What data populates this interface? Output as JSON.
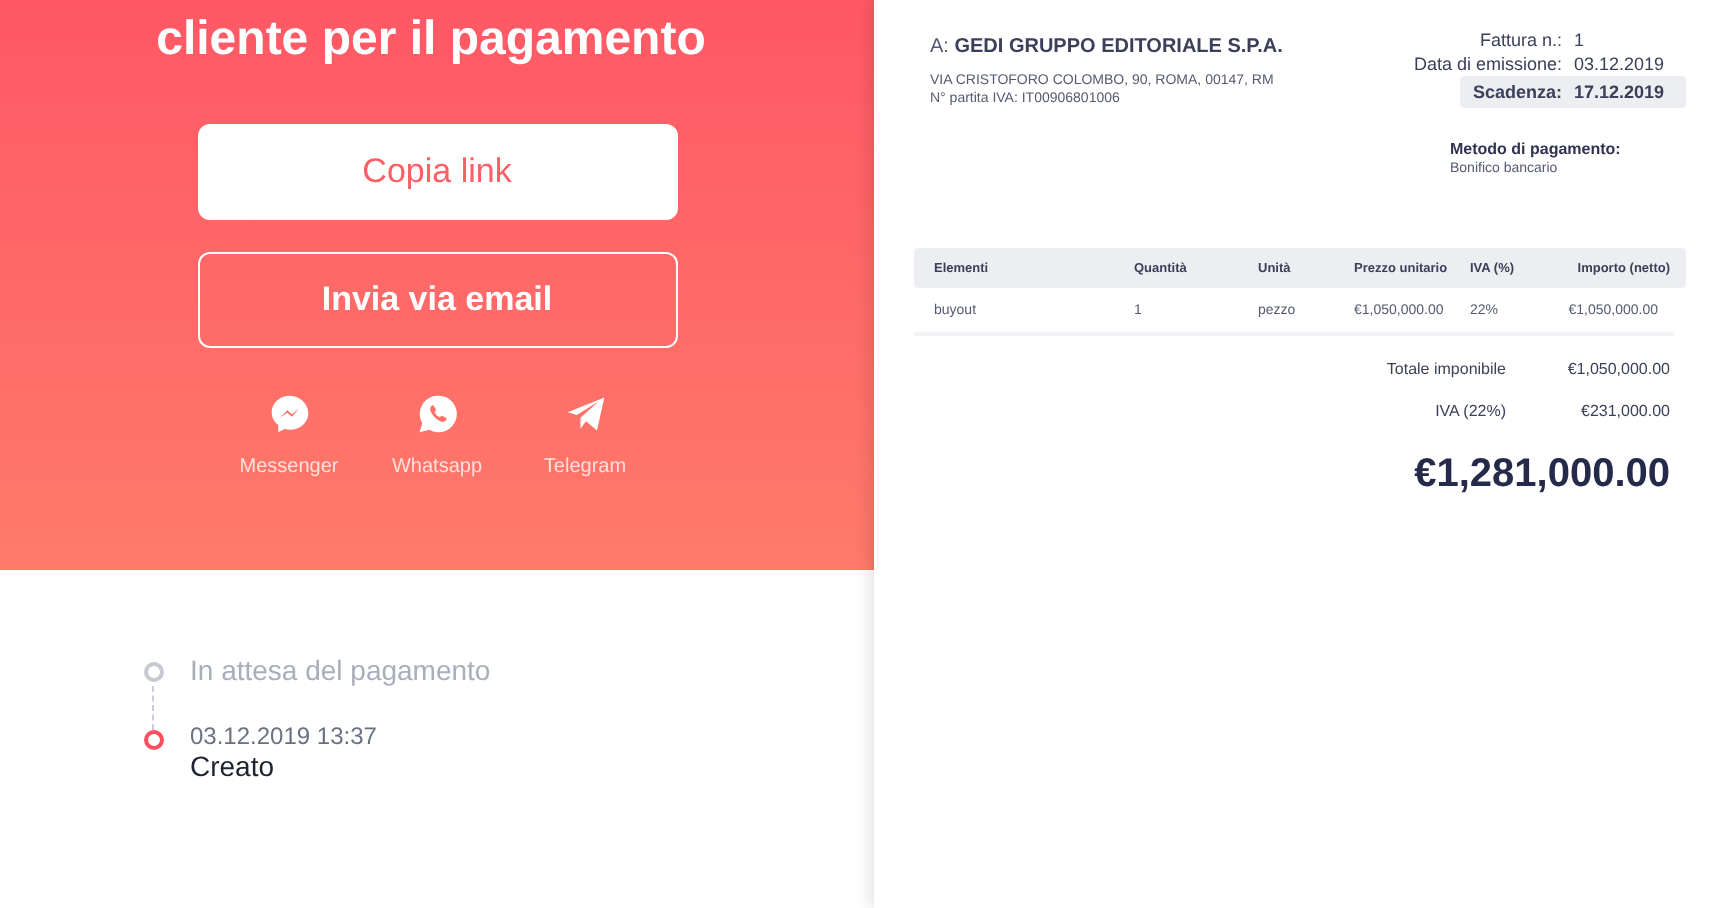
{
  "share": {
    "title": "cliente per il pagamento",
    "buttons": [
      {
        "label": "Copia link",
        "kind": "primary"
      },
      {
        "label": "Invia via email",
        "kind": "outline"
      }
    ],
    "channels": [
      {
        "label": "Messenger",
        "kind": "messenger"
      },
      {
        "label": "Whatsapp",
        "kind": "whatsapp"
      },
      {
        "label": "Telegram",
        "kind": "telegram"
      }
    ]
  },
  "timeline": [
    {
      "kind": "pending",
      "title": "In attesa del pagamento"
    },
    {
      "kind": "done",
      "time": "03.12.2019 13:37",
      "title": "Creato"
    }
  ],
  "invoice": {
    "recipient_prefix": "A:",
    "recipient": "GEDI GRUPPO EDITORIALE S.P.A.",
    "address": "VIA CRISTOFORO COLOMBO, 90, ROMA, 00147, RM",
    "vat": "N° partita IVA: IT00906801006",
    "meta": [
      {
        "label": "Fattura n.:",
        "value": "1",
        "highlight": false
      },
      {
        "label": "Data di emissione:",
        "value": "03.12.2019",
        "highlight": false
      },
      {
        "label": "Scadenza:",
        "value": "17.12.2019",
        "highlight": true
      }
    ],
    "payment_label": "Metodo di pagamento:",
    "payment_value": "Bonifico bancario",
    "columns": [
      "Elementi",
      "Quantità",
      "Unità",
      "Prezzo unitario",
      "IVA (%)",
      "Importo (netto)"
    ],
    "rows": [
      [
        "buyout",
        "1",
        "pezzo",
        "€1,050,000.00",
        "22%",
        "€1,050,000.00"
      ]
    ],
    "totals": [
      {
        "label": "Totale imponibile",
        "value": "€1,050,000.00"
      },
      {
        "label": "IVA (22%)",
        "value": "€231,000.00"
      }
    ],
    "grand_total": "€1,281,000.00"
  }
}
